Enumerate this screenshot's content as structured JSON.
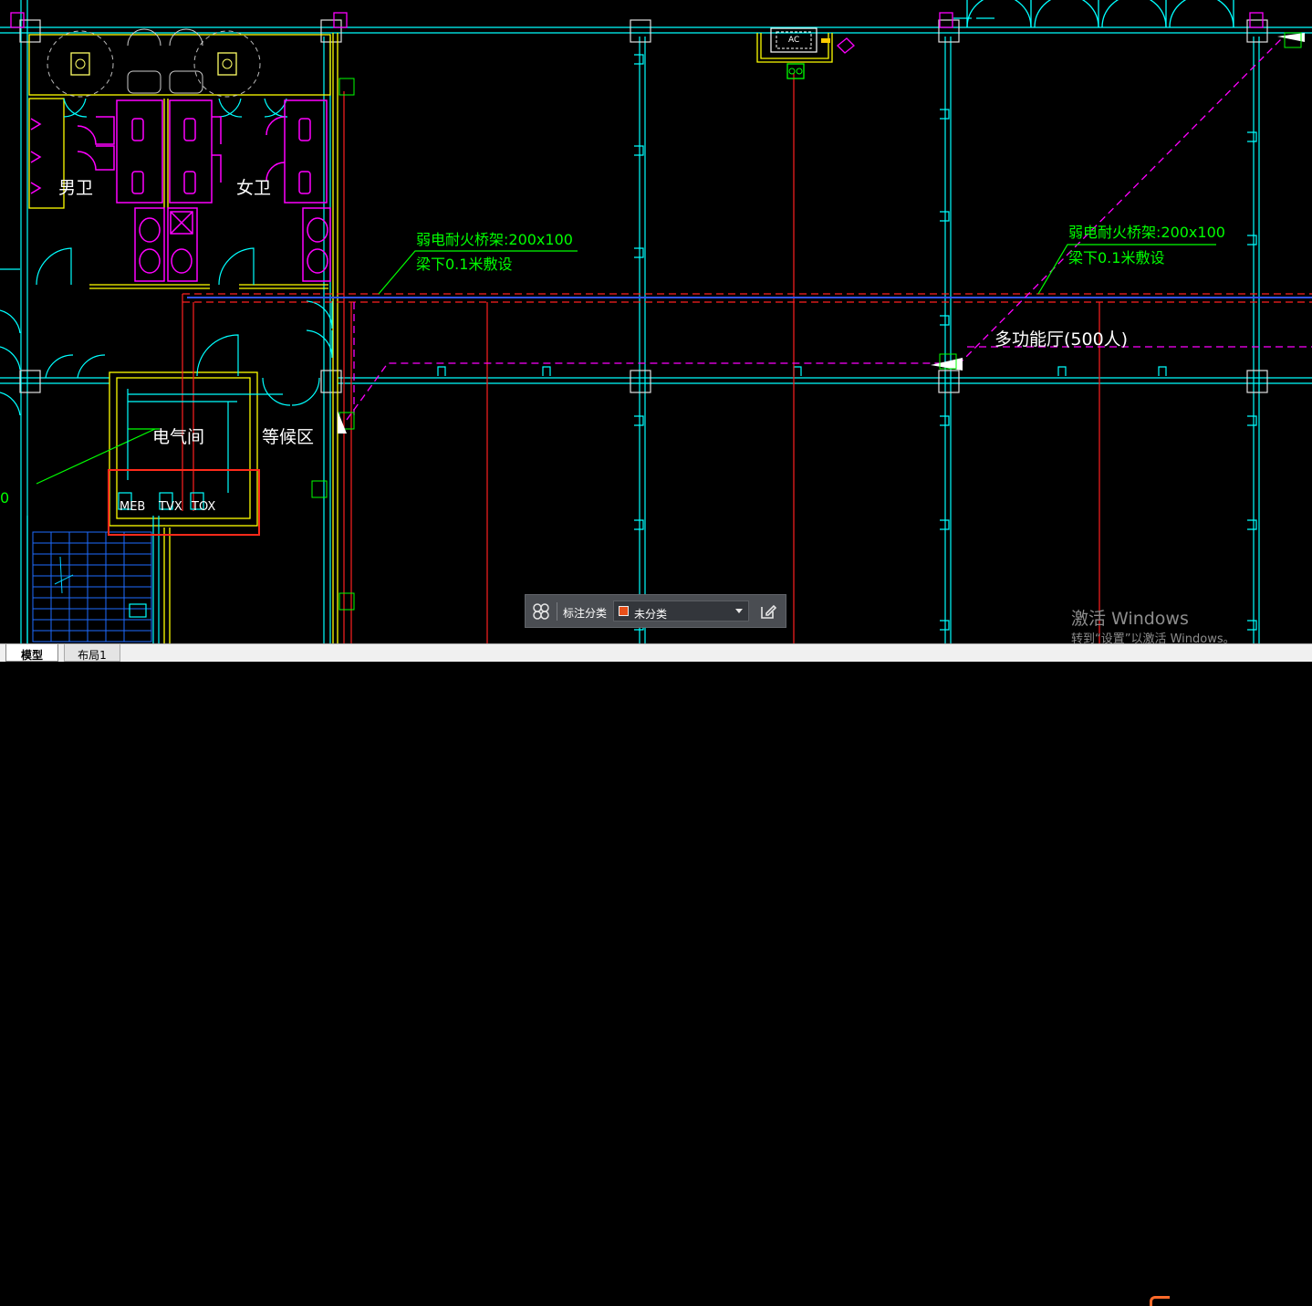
{
  "drawing": {
    "rooms": {
      "mens_toilet": "男卫",
      "womens_toilet": "女卫",
      "electrical_room": "电气间",
      "waiting_area": "等候区",
      "multi_hall": "多功能厅(500人)"
    },
    "annotations": {
      "tray_1_line1": "弱电耐火桥架:200x100",
      "tray_1_line2": "梁下0.1米敷设",
      "tray_2_line1": "弱电耐火桥架:200x100",
      "tray_2_line2": "梁下0.1米敷设",
      "left_edge_value": "0"
    },
    "equipment": {
      "ac_label": "AC",
      "meb": "MEB",
      "tvx": "TVX",
      "tox": "TOX"
    },
    "colors": {
      "background": "#000000",
      "grid": "#00ffff",
      "wall": "#ffff00",
      "fixture": "#ff00ff",
      "tray": "#ff0000",
      "annotation": "#00ff00",
      "highlight": "#ff2a1a"
    }
  },
  "toolbar": {
    "icon": "grid-dots-icon",
    "label": "标注分类",
    "select_value": "未分类",
    "swatch_color": "#e8501a",
    "edit_icon": "edit-icon"
  },
  "watermark": {
    "title": "激活 Windows",
    "subtitle": "转到“设置”以激活 Windows。"
  },
  "tabs": [
    {
      "label": "模型",
      "active": true
    },
    {
      "label": "布局1",
      "active": false
    }
  ]
}
